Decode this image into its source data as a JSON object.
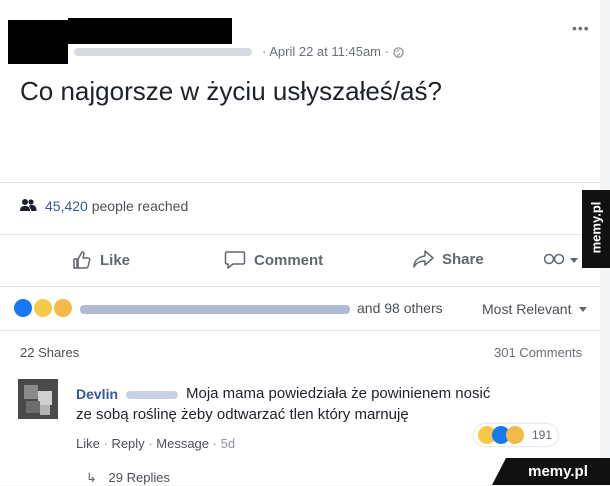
{
  "post": {
    "timestamp": "April 22 at 11:45am",
    "text": "Co najgorsze w życiu usłyszałeś/aś?",
    "more_icon": "more-horizontal-icon",
    "privacy_icon": "globe-icon"
  },
  "reach": {
    "count": "45,420",
    "label": "people reached",
    "icon": "people-icon"
  },
  "actions": {
    "like": "Like",
    "comment": "Comment",
    "share": "Share"
  },
  "reactions": {
    "others": "and 98 others",
    "sort": "Most Relevant",
    "emoji": [
      "like-icon",
      "haha-icon",
      "sad-icon"
    ]
  },
  "stats": {
    "shares": "22 Shares",
    "comments": "301 Comments"
  },
  "comment": {
    "author": "Devlin",
    "text_line1": "Moja mama powiedziała że powinienem nosić",
    "text_line2": "ze sobą roślinę żeby odtwarzać tlen który marnuję",
    "like": "Like",
    "reply": "Reply",
    "message": "Message",
    "time": "5d",
    "reaction_count": "191"
  },
  "replies": {
    "label": "29 Replies"
  },
  "watermark": {
    "side": "memy.pl",
    "bottom": "memy.pl"
  },
  "colors": {
    "link": "#365899",
    "text": "#1d2129",
    "muted": "#606770",
    "like_blue": "#1877f2",
    "haha_yellow": "#f7c948"
  }
}
